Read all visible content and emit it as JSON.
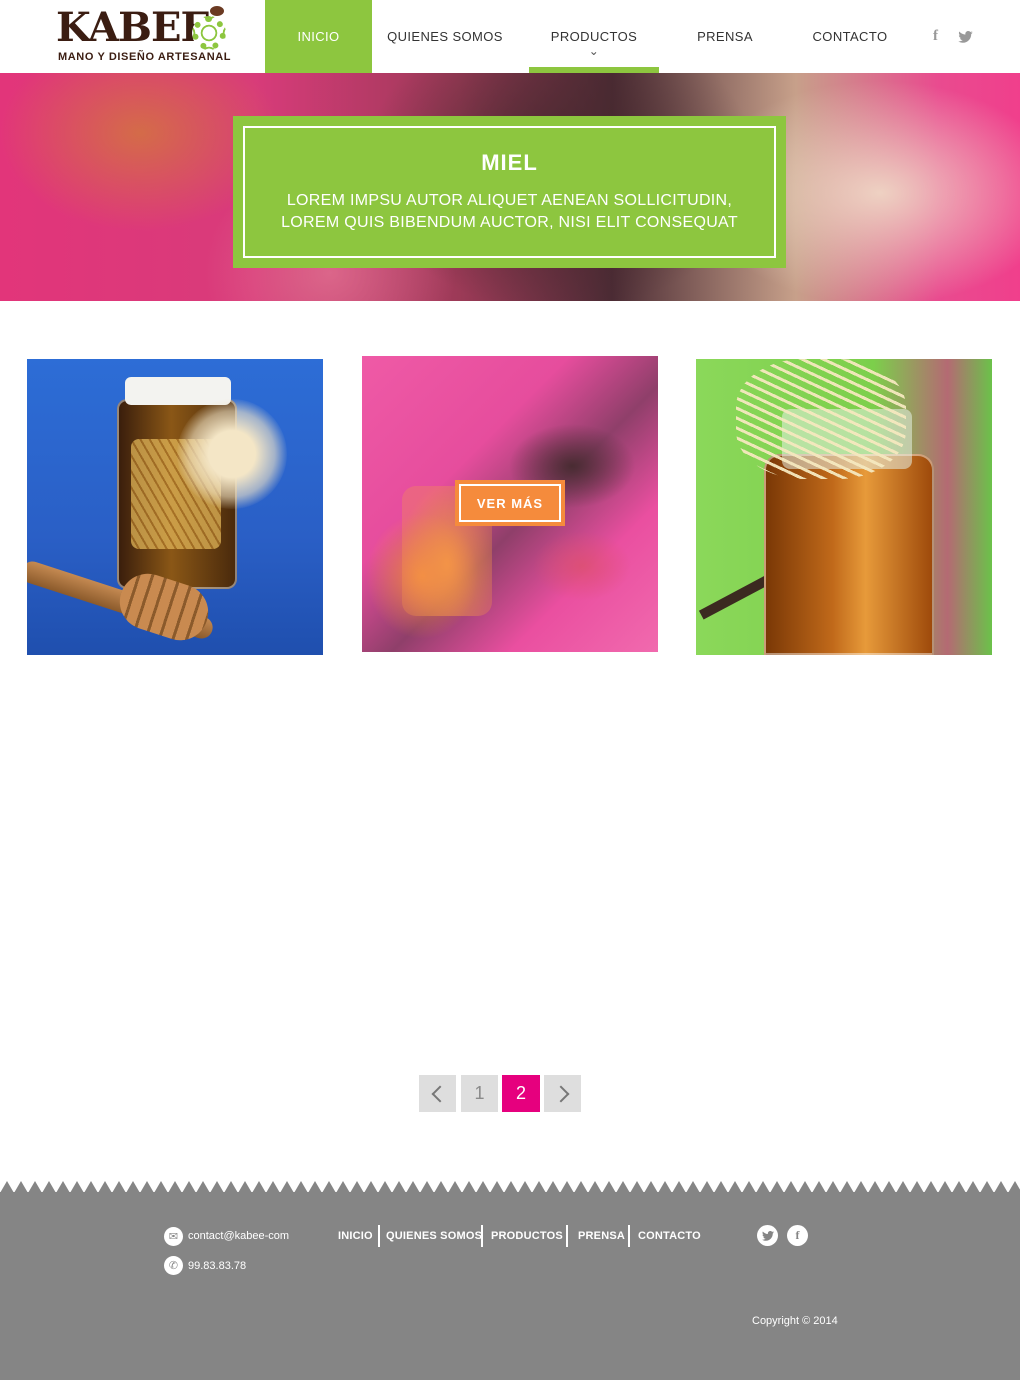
{
  "brand": {
    "name": "KABEE",
    "tagline": "MANO Y DISEÑO ARTESANAL"
  },
  "nav": {
    "items": [
      {
        "label": "INICIO",
        "active": true
      },
      {
        "label": "QUIENES SOMOS",
        "active": false
      },
      {
        "label": "PRODUCTOS",
        "active": false,
        "has_dropdown": true
      },
      {
        "label": "PRENSA",
        "active": false
      },
      {
        "label": "CONTACTO",
        "active": false
      }
    ],
    "social": [
      "facebook-icon",
      "twitter-icon"
    ]
  },
  "hero": {
    "title": "MIEL",
    "subtitle_line1": "LOREM IMPSU AUTOR ALIQUET AENEAN SOLLICITUDIN,",
    "subtitle_line2": "LOREM QUIS BIBENDUM AUCTOR, NISI ELIT CONSEQUAT"
  },
  "products": {
    "hover_button_label": "VER MÁS"
  },
  "pagination": {
    "pages": [
      "1",
      "2"
    ],
    "current_page": "2"
  },
  "footer": {
    "email": "contact@kabee-com",
    "phone": "99.83.83.78",
    "nav": [
      "INICIO",
      "QUIENES SOMOS",
      "PRODUCTOS",
      "PRENSA",
      "CONTACTO"
    ],
    "copyright": "Copyright © 2014"
  },
  "colors": {
    "accent_green": "#8dc63f",
    "pager_active": "#e6007e",
    "button_orange": "#f58b3c",
    "footer_gray": "#858585"
  }
}
